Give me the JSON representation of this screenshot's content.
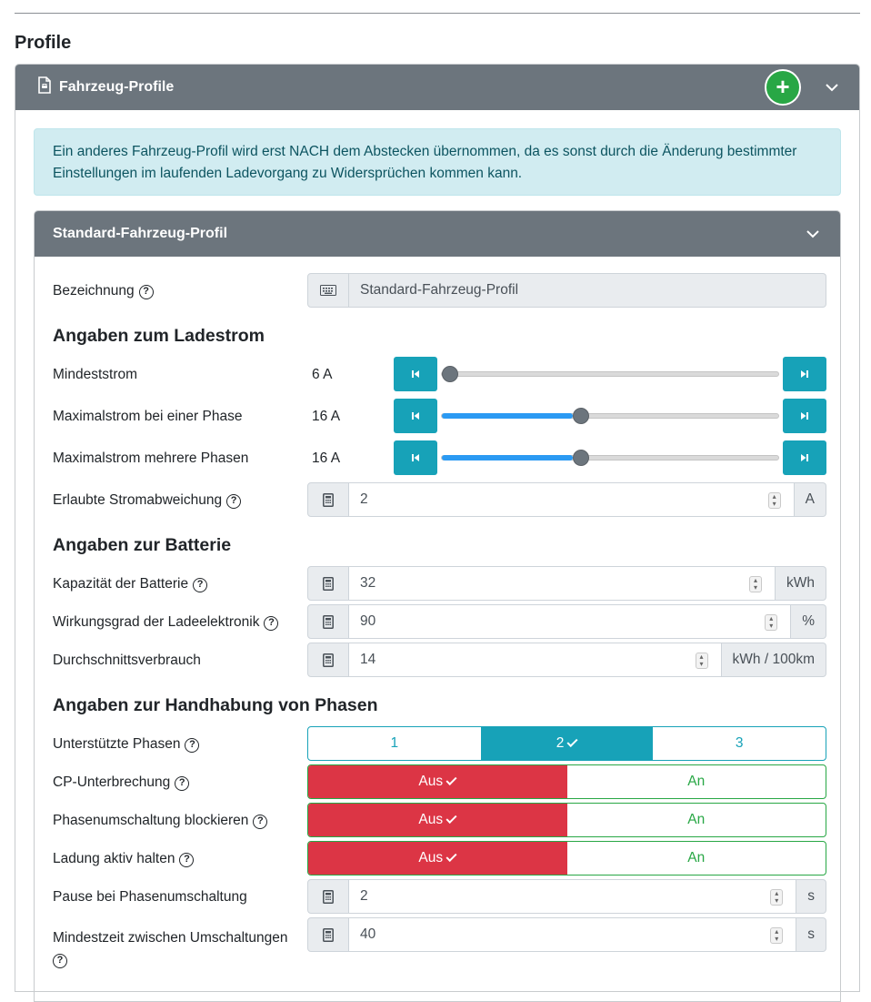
{
  "page": {
    "title": "Profile"
  },
  "vehicle_profiles": {
    "title": "Fahrzeug-Profile",
    "add_label": "+",
    "alert": "Ein anderes Fahrzeug-Profil wird erst NACH dem Abstecken übernommen, da es sonst durch die Änderung bestimmter Einstellungen im laufenden Ladevorgang zu Widersprüchen kommen kann."
  },
  "profile": {
    "title": "Standard-Fahrzeug-Profil",
    "name_label": "Bezeichnung",
    "name_value": "Standard-Fahrzeug-Profil",
    "help_glyph": "?"
  },
  "charging_current": {
    "heading": "Angaben zum Ladestrom",
    "min_current": {
      "label": "Mindeststrom",
      "value": "6 A",
      "level": 0.0
    },
    "max_single": {
      "label": "Maximalstrom bei einer Phase",
      "value": "16 A",
      "level": 0.39
    },
    "max_multi": {
      "label": "Maximalstrom mehrere Phasen",
      "value": "16 A",
      "level": 0.39
    },
    "deviation": {
      "label": "Erlaubte Stromabweichung",
      "value": "2",
      "unit": "A"
    }
  },
  "battery": {
    "heading": "Angaben zur Batterie",
    "capacity": {
      "label": "Kapazität der Batterie",
      "value": "32",
      "unit": "kWh"
    },
    "efficiency": {
      "label": "Wirkungsgrad der Ladeelektronik",
      "value": "90",
      "unit": "%"
    },
    "consumption": {
      "label": "Durchschnittsverbrauch",
      "value": "14",
      "unit": "kWh / 100km"
    }
  },
  "phases": {
    "heading": "Angaben zur Handhabung von Phasen",
    "supported": {
      "label": "Unterstützte Phasen",
      "options": [
        "1",
        "2",
        "3"
      ],
      "selected": "2"
    },
    "cp_interrupt": {
      "label": "CP-Unterbrechung",
      "off": "Aus",
      "on": "An"
    },
    "block_switch": {
      "label": "Phasenumschaltung blockieren",
      "off": "Aus",
      "on": "An"
    },
    "keep_active": {
      "label": "Ladung aktiv halten",
      "off": "Aus",
      "on": "An"
    },
    "pause": {
      "label": "Pause bei Phasenumschaltung",
      "value": "2",
      "unit": "s"
    },
    "min_time": {
      "label": "Mindestzeit zwischen Umschaltungen",
      "value": "40",
      "unit": "s"
    }
  },
  "colors": {
    "header": "#6c757d",
    "info": "#17a2b8",
    "danger": "#dc3545",
    "success": "#28a745",
    "alert_bg": "#d1ecf1"
  }
}
